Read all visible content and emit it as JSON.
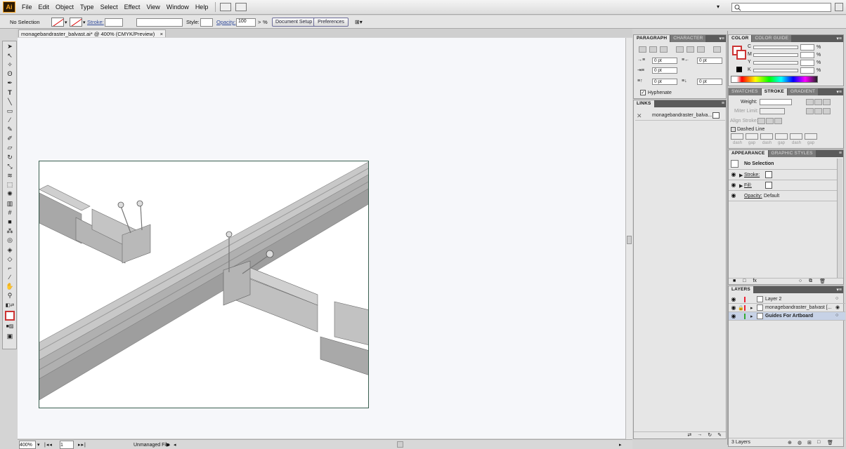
{
  "menubar": {
    "logo": "Ai",
    "items": [
      "File",
      "Edit",
      "Object",
      "Type",
      "Select",
      "Effect",
      "View",
      "Window",
      "Help"
    ]
  },
  "control": {
    "selection": "No Selection",
    "stroke_label": "Stroke:",
    "style_label": "Style:",
    "opacity_label": "Opacity:",
    "opacity_value": "100",
    "percent": "%",
    "doc_setup": "Document Setup",
    "preferences": "Preferences"
  },
  "document": {
    "tab_title": "monagebandraster_balvast.ai* @ 400% (CMYK/Preview)",
    "close_glyph": "×"
  },
  "status": {
    "zoom": "400%",
    "page": "1",
    "info": "Unmanaged File"
  },
  "paragraph": {
    "tabs": [
      "PARAGRAPH",
      "CHARACTER"
    ],
    "values": [
      "0 pt",
      "0 pt",
      "0 pt",
      "0 pt",
      "0 pt"
    ],
    "hyphenate": "Hyphenate"
  },
  "links": {
    "tab": "LINKS",
    "item": "monagebandraster_balva..."
  },
  "color": {
    "tabs": [
      "COLOR",
      "COLOR GUIDE"
    ],
    "channels": [
      "C",
      "M",
      "Y",
      "K"
    ],
    "percent": "%"
  },
  "stroke": {
    "tabs": [
      "SWATCHES",
      "STROKE",
      "GRADIENT"
    ],
    "weight": "Weight:",
    "miter": "Miter Limit:",
    "align": "Align Stroke:",
    "dashed": "Dashed Line",
    "dash_labels": [
      "dash",
      "gap",
      "dash",
      "gap",
      "dash",
      "gap"
    ]
  },
  "appearance": {
    "tabs": [
      "APPEARANCE",
      "GRAPHIC STYLES"
    ],
    "title": "No Selection",
    "stroke": "Stroke:",
    "fill": "Fill:",
    "opacity": "Opacity:",
    "opacity_value": "Default"
  },
  "layers": {
    "tab": "LAYERS",
    "rows": [
      "Layer 2",
      "monagebandraster_balvast [...",
      "Guides For Artboard"
    ],
    "count": "3 Layers"
  },
  "colors": {
    "accent": "#f7a21b",
    "panel_tab_dark": "#5b5b5b",
    "selected_layer": "#c7d2e6"
  }
}
